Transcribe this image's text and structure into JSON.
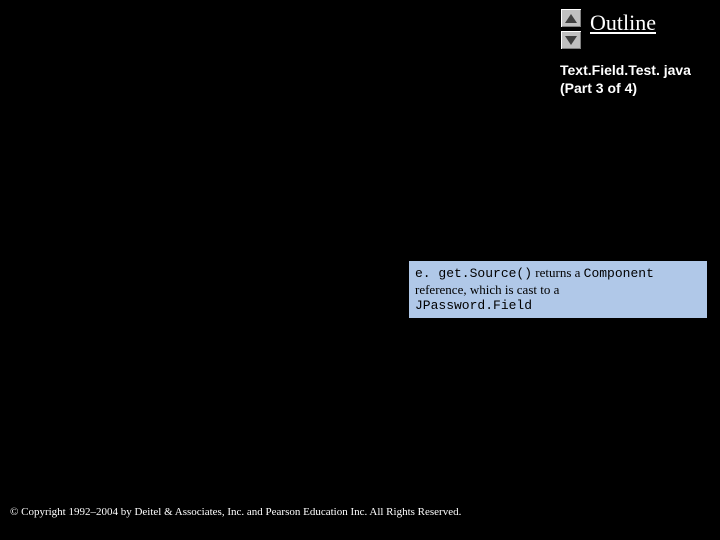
{
  "header": {
    "outline": "Outline",
    "file_line1": "Text.Field.Test. java",
    "file_line2": "(Part 3 of 4)"
  },
  "callout": {
    "code1": "e. get.Source()",
    "text1": " returns a ",
    "code2": "Component",
    "text2": "reference, which is cast to a",
    "code3": "JPassword.Field"
  },
  "footer": {
    "copyright": "© Copyright 1992–2004 by Deitel & Associates, Inc. and Pearson Education Inc. All Rights Reserved."
  }
}
